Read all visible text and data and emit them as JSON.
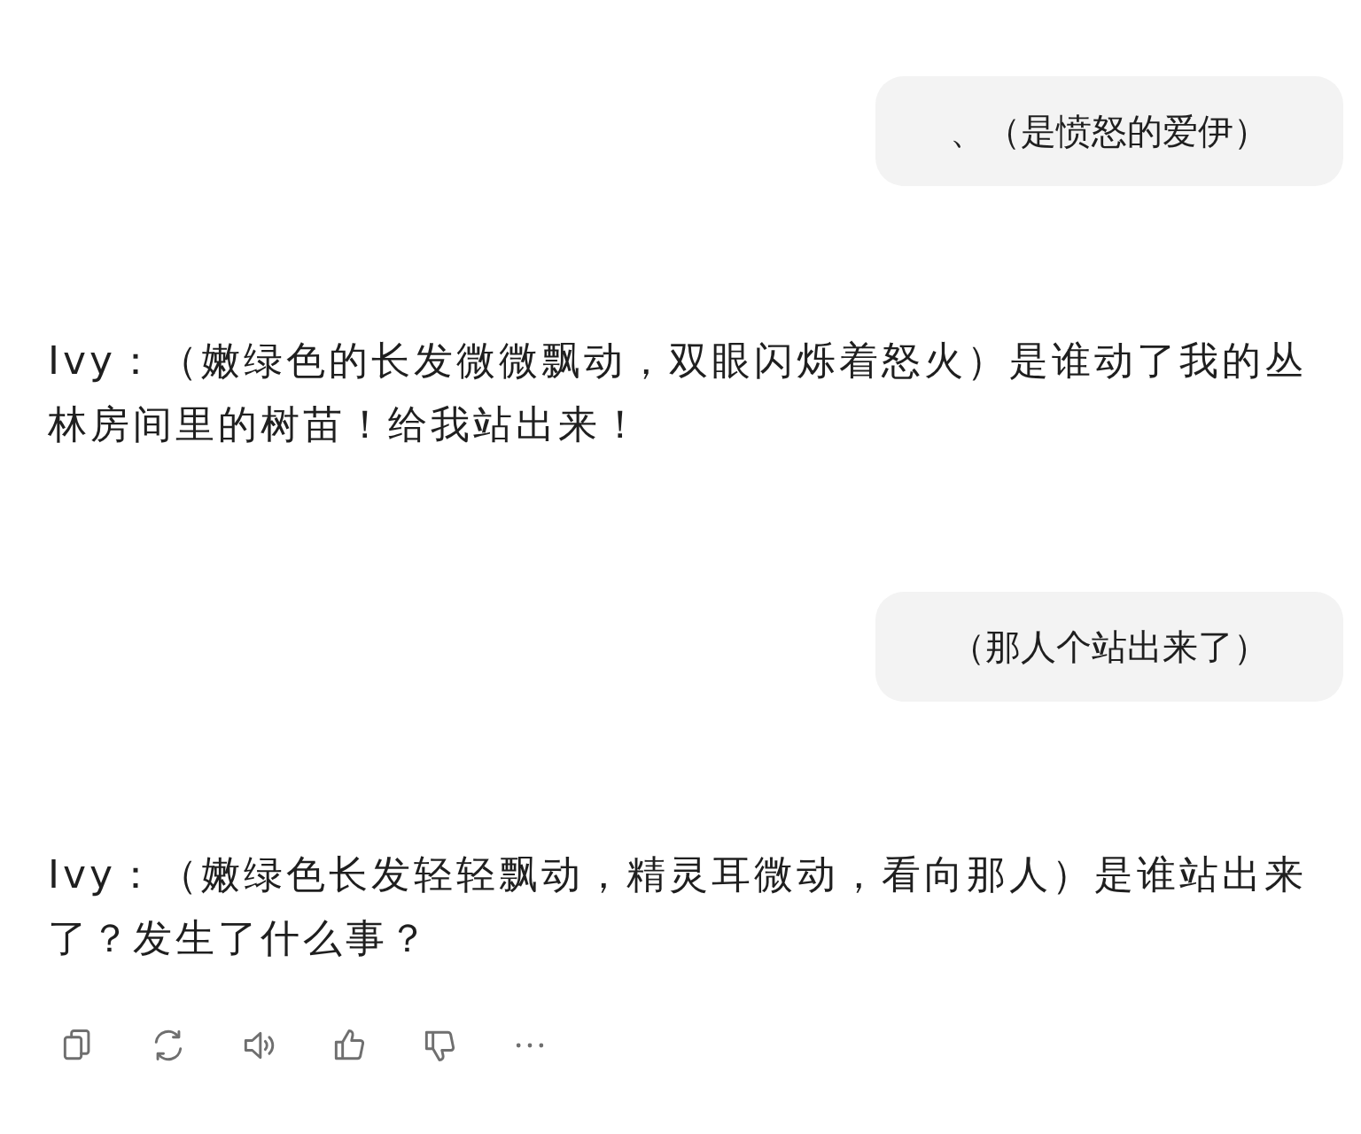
{
  "messages": [
    {
      "kind": "user",
      "text": "、（是愤怒的爱伊）"
    },
    {
      "kind": "assistant",
      "text": "Ivy：（嫩绿色的长发微微飘动，双眼闪烁着怒火）是谁动了我的丛林房间里的树苗！给我站出来！"
    },
    {
      "kind": "user",
      "text": "（那人个站出来了）"
    },
    {
      "kind": "assistant",
      "text": "Ivy：（嫩绿色长发轻轻飘动，精灵耳微动，看向那人）是谁站出来了？发生了什么事？"
    }
  ]
}
